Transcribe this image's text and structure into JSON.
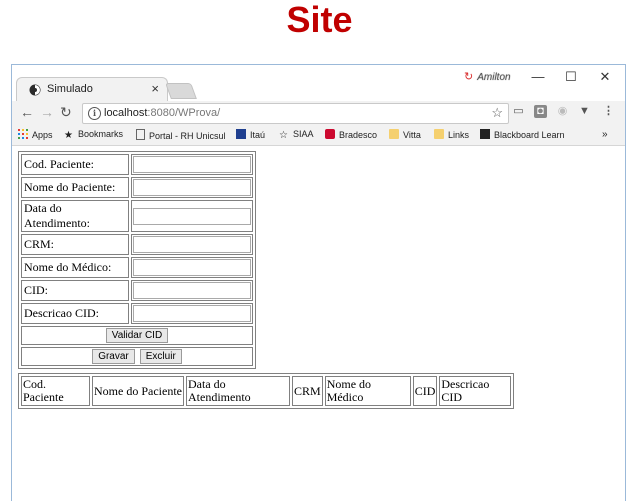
{
  "slide": {
    "title": "Site"
  },
  "browser": {
    "tab": {
      "title": "Simulado",
      "close": "×"
    },
    "profile": {
      "name": "Amilton"
    },
    "window": {
      "minimize": "—",
      "maximize": "☐",
      "close": "✕"
    },
    "nav": {
      "back": "←",
      "forward": "→",
      "reload": "↻"
    },
    "address": {
      "host": "localhost",
      "path": ":8080/WProva/"
    },
    "bookmarks": [
      "Apps",
      "Bookmarks",
      "Portal - RH Unicsul",
      "Itaú",
      "SIAA",
      "Bradesco",
      "Vitta",
      "Links",
      "Blackboard Learn"
    ],
    "bookmarks_more": "»"
  },
  "form": {
    "fields": [
      {
        "label": "Cod. Paciente:",
        "value": ""
      },
      {
        "label": "Nome do Paciente:",
        "value": ""
      },
      {
        "label": "Data do Atendimento:",
        "value": ""
      },
      {
        "label": "CRM:",
        "value": ""
      },
      {
        "label": "Nome do Médico:",
        "value": ""
      },
      {
        "label": "CID:",
        "value": ""
      },
      {
        "label": "Descricao CID:",
        "value": ""
      }
    ],
    "validate_button": "Validar CID",
    "save_button": "Gravar",
    "delete_button": "Excluir"
  },
  "grid": {
    "columns": [
      "Cod. Paciente",
      "Nome do Paciente",
      "Data do Atendimento",
      "CRM",
      "Nome do Médico",
      "CID",
      "Descricao CID"
    ]
  }
}
